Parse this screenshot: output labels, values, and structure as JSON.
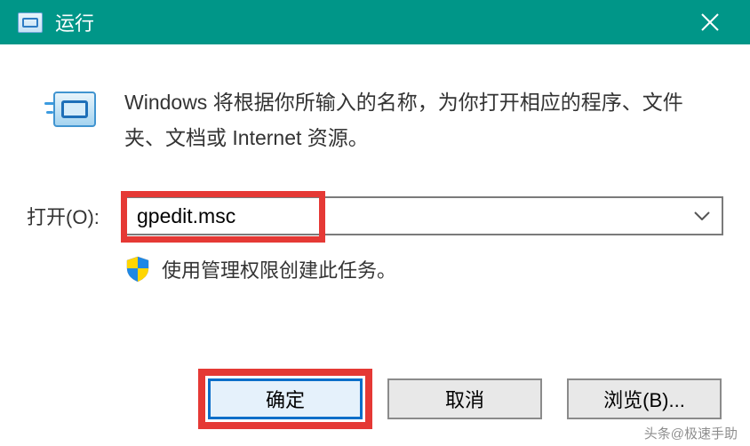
{
  "titlebar": {
    "title": "运行"
  },
  "description": "Windows 将根据你所输入的名称，为你打开相应的程序、文件夹、文档或 Internet 资源。",
  "open": {
    "label": "打开(O):",
    "value": "gpedit.msc"
  },
  "admin_note": "使用管理权限创建此任务。",
  "buttons": {
    "ok": "确定",
    "cancel": "取消",
    "browse": "浏览(B)..."
  },
  "watermark": "头条@极速手助"
}
